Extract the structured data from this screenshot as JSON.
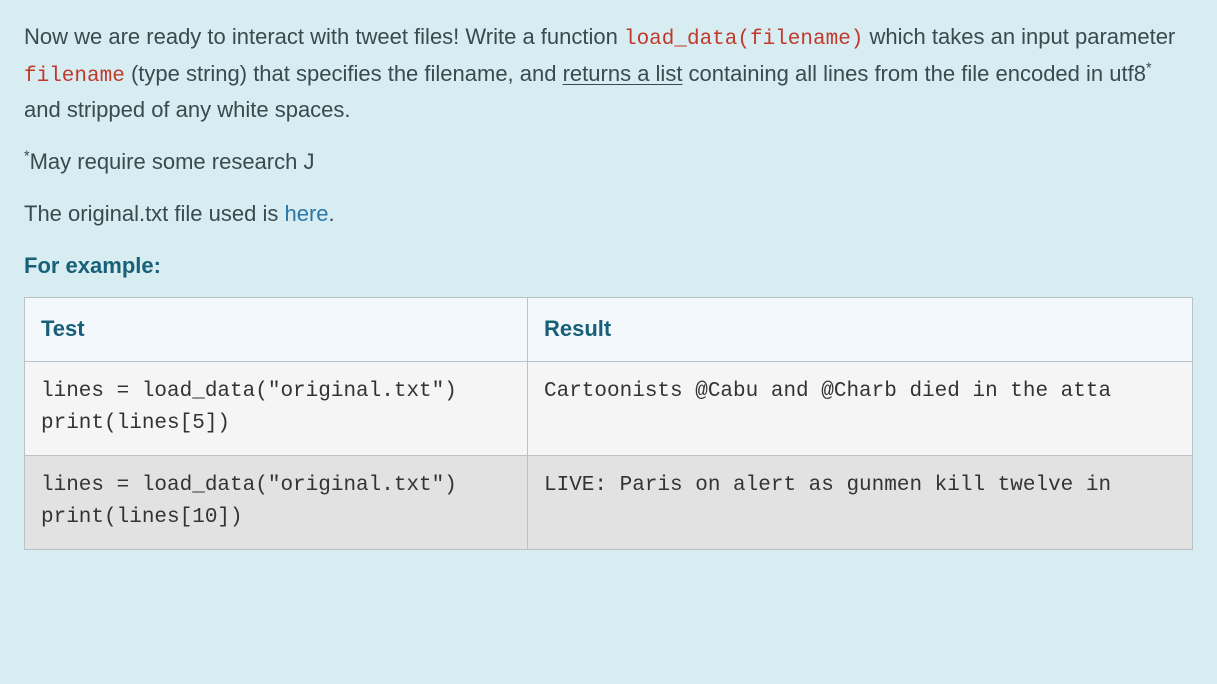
{
  "intro": {
    "part1": "Now we are ready to interact with tweet files! Write a function ",
    "code1": "load_data(filename)",
    "part2": " which takes an input parameter ",
    "code2": "filename",
    "part3": " (type string) that specifies the filename, and ",
    "underlined": "returns a list",
    "part4": " containing all lines from the file encoded in utf8",
    "sup": "*",
    "part5": " and stripped of any white spaces."
  },
  "footnote": {
    "star": "*",
    "text": "May require some research J"
  },
  "file_sentence": {
    "before": "The original.txt file used is ",
    "link": "here",
    "after": "."
  },
  "example_label": "For example:",
  "table": {
    "headers": {
      "test": "Test",
      "result": "Result"
    },
    "rows": [
      {
        "test": "lines = load_data(\"original.txt\")\nprint(lines[5])",
        "result": "Cartoonists @Cabu and @Charb died in the atta"
      },
      {
        "test": "lines = load_data(\"original.txt\")\nprint(lines[10])",
        "result": "LIVE: Paris on alert as gunmen kill twelve in"
      }
    ]
  }
}
